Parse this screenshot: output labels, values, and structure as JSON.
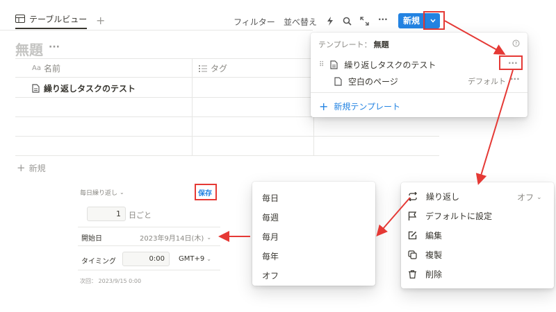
{
  "tabs": {
    "active": "テーブルビュー",
    "add": "+"
  },
  "toolbar": {
    "filter": "フィルター",
    "sort": "並べ替え",
    "more": "···",
    "new_label": "新規"
  },
  "page": {
    "title": "無題",
    "title_more": "···"
  },
  "table": {
    "col_name_prefix": "Aa",
    "col_name": "名前",
    "col_tag": "タグ",
    "rows": [
      "繰り返しタスクのテスト",
      "",
      "",
      ""
    ],
    "add_row": "新規"
  },
  "template_menu": {
    "header_prefix": "テンプレート：",
    "header_name": "無題",
    "items": [
      {
        "label": "繰り返しタスクのテスト",
        "more": "···"
      },
      {
        "label": "空白のページ",
        "badge": "デフォルト",
        "more": "···"
      }
    ],
    "new_template": "新規テンプレート"
  },
  "repeat_settings": {
    "frequency": "毎日繰り返し",
    "save": "保存",
    "interval_value": "1",
    "interval_unit": "日ごと",
    "start_label": "開始日",
    "start_value": "2023年9月14日(木)",
    "timing_label": "タイミング",
    "time_value": "0:00",
    "timezone": "GMT+9",
    "next": "次回： 2023/9/15 0:00"
  },
  "frequency_menu": {
    "options": [
      "毎日",
      "毎週",
      "毎月",
      "毎年",
      "オフ"
    ]
  },
  "context_menu": {
    "items": [
      {
        "label": "繰り返し",
        "value": "オフ",
        "icon": "repeat-icon"
      },
      {
        "label": "デフォルトに設定",
        "icon": "flag-icon"
      },
      {
        "label": "編集",
        "icon": "edit-icon"
      },
      {
        "label": "複製",
        "icon": "duplicate-icon"
      },
      {
        "label": "削除",
        "icon": "trash-icon"
      }
    ]
  },
  "colors": {
    "accent": "#2383e2",
    "annotation": "#e53935"
  }
}
